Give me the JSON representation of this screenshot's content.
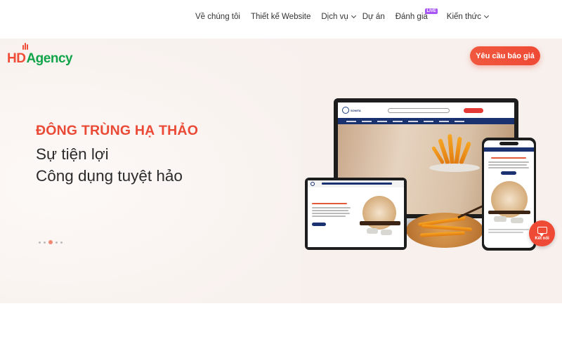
{
  "brand": {
    "logo_hd": "HD",
    "logo_agency": "Agency",
    "primary_color": "#ee4c36",
    "secondary_color": "#12a44a"
  },
  "nav": {
    "items": [
      {
        "label": "Về chúng tôi",
        "has_dropdown": false
      },
      {
        "label": "Thiết kế Website",
        "has_dropdown": false
      },
      {
        "label": "Dịch vụ",
        "has_dropdown": true
      },
      {
        "label": "Dự án",
        "has_dropdown": false
      },
      {
        "label": "Đánh giá",
        "has_dropdown": false,
        "badge": "LIVE"
      },
      {
        "label": "Kiến thức",
        "has_dropdown": true
      }
    ],
    "cta_label": "Yêu cầu báo giá"
  },
  "hero": {
    "title": "ĐÔNG TRÙNG HẠ THẢO",
    "line1": "Sự tiện lợi",
    "line2": "Công dụng tuyệt hảo",
    "slides_total": 5,
    "slide_active": 3
  },
  "mockup": {
    "brand_name": "SONITA"
  },
  "chat": {
    "label": "Kết nối"
  }
}
